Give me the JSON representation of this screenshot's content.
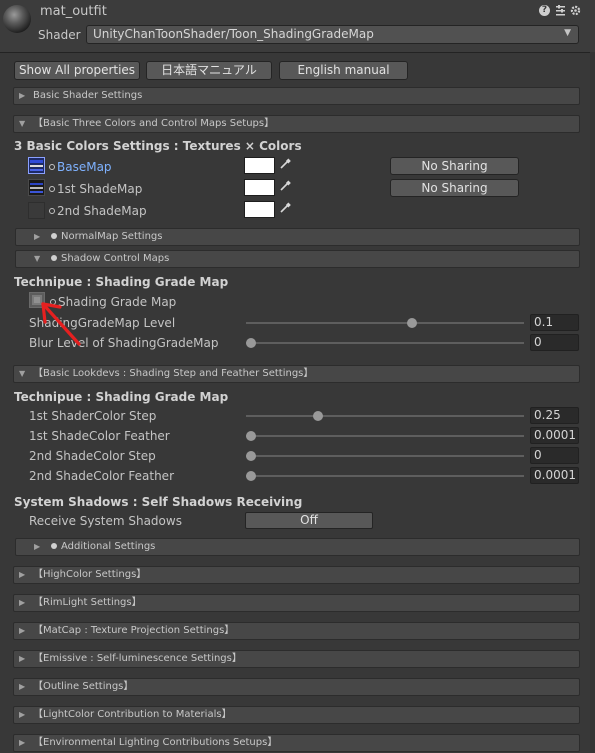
{
  "header": {
    "material_name": "mat_outfit",
    "shader_label": "Shader",
    "shader_value": "UnityChanToonShader/Toon_ShadingGradeMap"
  },
  "top_buttons": {
    "show_all": "Show All properties",
    "japanese_manual": "日本語マニュアル",
    "english_manual": "English manual"
  },
  "sections": {
    "basic_shader": "Basic Shader Settings",
    "basic_three_colors": "【Basic Three Colors and Control Maps Setups】",
    "normal_map": "NormalMap Settings",
    "shadow_control": "Shadow Control Maps",
    "basic_lookdevs": "【Basic Lookdevs : Shading Step and Feather Settings】",
    "additional": "Additional Settings",
    "highcolor": "【HighColor Settings】",
    "rimlight": "【RimLight Settings】",
    "matcap": "【MatCap : Texture Projection Settings】",
    "emissive": "【Emissive : Self-luminescence Settings】",
    "outline": "【Outline Settings】",
    "lightcolor": "【LightColor Contribution to Materials】",
    "environmental": "【Environmental Lighting Contributions Setups】"
  },
  "three_colors": {
    "heading": "3 Basic Colors Settings : Textures × Colors",
    "rows": [
      {
        "label": "BaseMap",
        "sharing": "No Sharing"
      },
      {
        "label": "1st ShadeMap",
        "sharing": "No Sharing"
      },
      {
        "label": "2nd ShadeMap"
      }
    ]
  },
  "shading_grade": {
    "heading": "Technipue : Shading Grade Map",
    "map_label": "Shading Grade Map",
    "level_label": "ShadingGradeMap Level",
    "level_value": "0.1",
    "level_fraction": 0.6,
    "blur_label": "Blur Level of ShadingGradeMap",
    "blur_value": "0",
    "blur_fraction": 0.0
  },
  "lookdevs": {
    "heading": "Technipue : Shading Grade Map",
    "rows": [
      {
        "label": "1st ShaderColor Step",
        "value": "0.25",
        "fraction": 0.25
      },
      {
        "label": "1st ShadeColor Feather",
        "value": "0.0001",
        "fraction": 0.0
      },
      {
        "label": "2nd ShadeColor Step",
        "value": "0",
        "fraction": 0.0
      },
      {
        "label": "2nd ShadeColor Feather",
        "value": "0.0001",
        "fraction": 0.0
      }
    ]
  },
  "system_shadows": {
    "heading": "System Shadows : Self Shadows Receiving",
    "label": "Receive System Shadows",
    "toggle": "Off"
  },
  "colors": {
    "link_blue": "#7fb2ff",
    "annotation_red": "#e62020"
  },
  "icons": [
    "help-icon",
    "settings-sliders-icon",
    "gear-icon",
    "eyedropper-icon"
  ]
}
